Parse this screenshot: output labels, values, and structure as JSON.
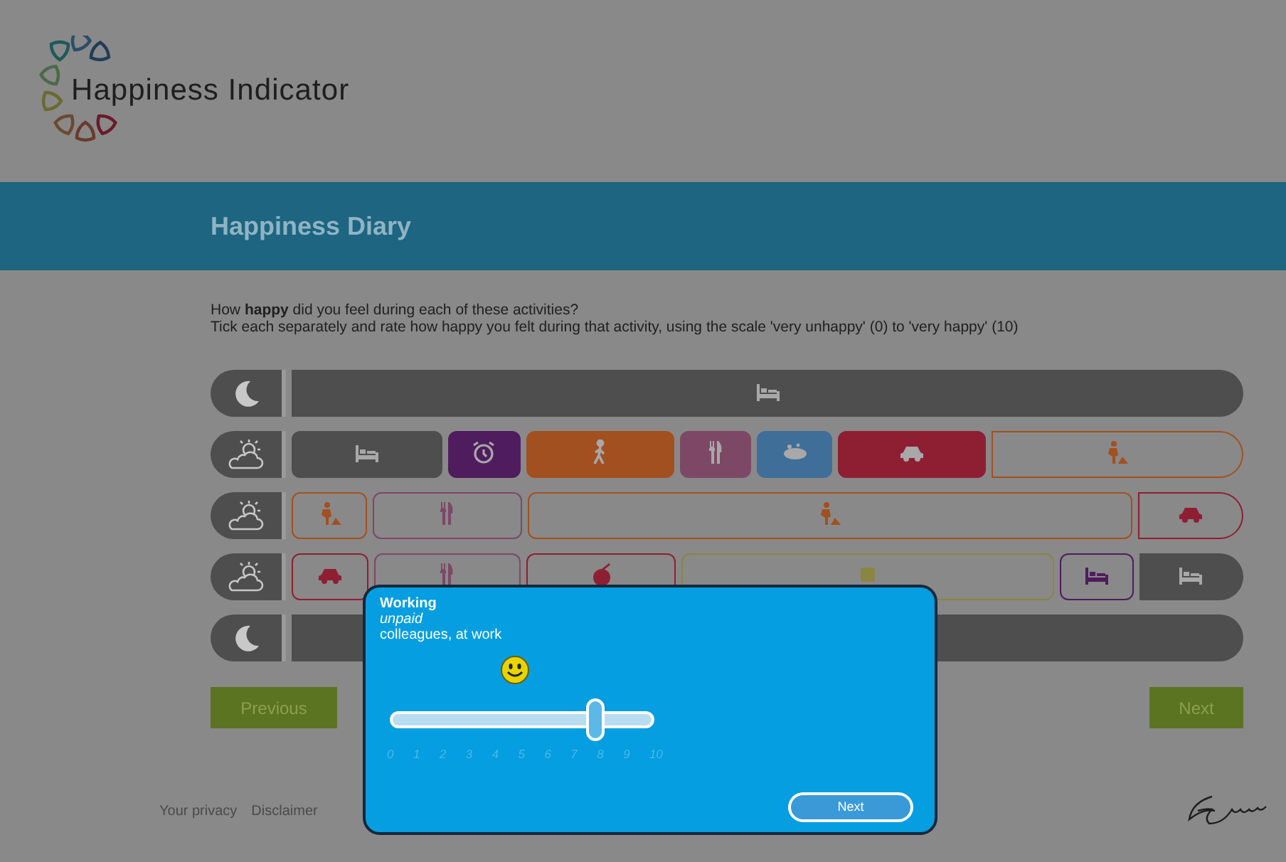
{
  "logo": {
    "title": "Happiness Indicator"
  },
  "banner": {
    "title": "Happiness Diary"
  },
  "instructions": [
    "How **happy** did you feel during each of these activities?",
    "Tick each separately and rate how happy you felt during that activity, using the scale 'very unhappy' (0) to 'very happy' (10)"
  ],
  "rows": [
    {
      "kind": "night",
      "segments": [
        {
          "kind": "sleep",
          "color": "#4e4e4e",
          "filled": true
        }
      ]
    },
    {
      "kind": "day",
      "segments": [
        {
          "kind": "sleep",
          "color": "#4e4e4e",
          "filled": true
        },
        {
          "kind": "alarm",
          "color": "#4f1c5e",
          "filled": true
        },
        {
          "kind": "walking",
          "color": "#a2501f",
          "filled": true
        },
        {
          "kind": "eating",
          "color": "#7d4866",
          "filled": true
        },
        {
          "kind": "washing",
          "color": "#3f6f98",
          "filled": true
        },
        {
          "kind": "car",
          "color": "#8e1f33",
          "filled": true
        },
        {
          "kind": "working",
          "color": "#a2501f",
          "filled": false
        }
      ]
    },
    {
      "kind": "day",
      "segments": [
        {
          "kind": "working",
          "color": "#a2501f",
          "filled": false
        },
        {
          "kind": "eating",
          "color": "#7d4866",
          "filled": false
        },
        {
          "kind": "working",
          "color": "#a2501f",
          "filled": false
        },
        {
          "kind": "car",
          "color": "#8e1f33",
          "filled": false
        }
      ]
    },
    {
      "kind": "day",
      "segments": [
        {
          "kind": "car",
          "color": "#8e1f33",
          "filled": false
        },
        {
          "kind": "eating",
          "color": "#7d4866",
          "filled": false
        },
        {
          "kind": "apple",
          "color": "#8e1f33",
          "filled": false
        },
        {
          "kind": "other",
          "color": "#8a8540",
          "filled": false
        },
        {
          "kind": "sleep",
          "color": "#4f1c5e",
          "filled": false
        },
        {
          "kind": "sleep",
          "color": "#4e4e4e",
          "filled": true
        }
      ]
    },
    {
      "kind": "night",
      "segments": [
        {
          "kind": "none",
          "color": "#4e4e4e",
          "filled": true
        }
      ]
    }
  ],
  "buttons": {
    "previous": "Previous",
    "next": "Next"
  },
  "footer": {
    "links": [
      "Your privacy",
      "Disclaimer"
    ]
  },
  "dialog": {
    "title": "Working",
    "subtitle": "unpaid",
    "detail": "colleagues, at work",
    "slider": {
      "level": 0.8,
      "ticks": [
        "0",
        "1",
        "2",
        "3",
        "4",
        "5",
        "6",
        "7",
        "8",
        "9",
        "10"
      ]
    },
    "button": "Next"
  }
}
